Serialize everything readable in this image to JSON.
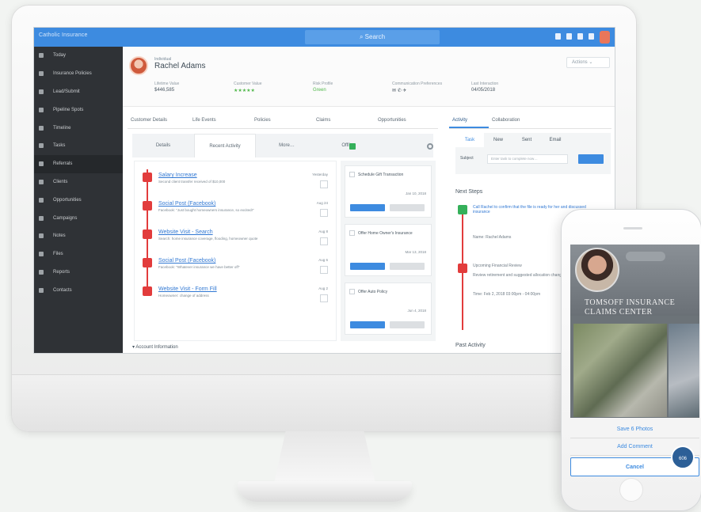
{
  "topbar": {
    "brand": "Catholic Insurance",
    "search_label": "Search"
  },
  "sidebar": {
    "items": [
      {
        "label": "Today"
      },
      {
        "label": "Insurance Policies"
      },
      {
        "label": "Lead/Submit"
      },
      {
        "label": "Pipeline Spots"
      },
      {
        "label": "Timeline"
      },
      {
        "label": "Tasks"
      },
      {
        "label": "Referrals"
      },
      {
        "label": "Clients"
      },
      {
        "label": "Opportunities"
      },
      {
        "label": "Campaigns"
      },
      {
        "label": "Notes"
      },
      {
        "label": "Files"
      },
      {
        "label": "Reports"
      },
      {
        "label": "Contacts"
      }
    ]
  },
  "profile": {
    "subtitle": "Individual",
    "name": "Rachel Adams",
    "actions_label": "Actions",
    "stats": [
      {
        "label": "Lifetime Value",
        "value": "$446,585"
      },
      {
        "label": "Customer Value",
        "value": "★★★★★",
        "green": true
      },
      {
        "label": "Risk Profile",
        "value": "Green",
        "green": true
      },
      {
        "label": "Communication Preferences",
        "value": "✉ ✆ ✈",
        "green": false
      },
      {
        "label": "Last Interaction",
        "value": "04/05/2018"
      }
    ]
  },
  "tabs": [
    "Customer Details",
    "Life Events",
    "Policies",
    "Claims",
    "Opportunities"
  ],
  "right_tabs": [
    "Activity",
    "Collaboration"
  ],
  "subtabs": [
    "Details",
    "Recent Activity",
    "More…",
    "Offline"
  ],
  "feed": [
    {
      "title": "Salary Increase",
      "desc": "Second client transfer received of $10,000",
      "time": "Yesterday"
    },
    {
      "title": "Social Post (Facebook)",
      "desc": "Facebook: \"Just bought homeowners insurance, so excited!\"",
      "time": "Aug 24"
    },
    {
      "title": "Website Visit - Search",
      "desc": "Search: home insurance coverage, flooding, homeowner quote",
      "time": "Aug 8"
    },
    {
      "title": "Social Post (Facebook)",
      "desc": "Facebook: \"Whatever insurance we have better off\"",
      "time": "Aug 6"
    },
    {
      "title": "Website Visit - Form Fill",
      "desc": "Homeowner: change of address",
      "time": "Aug 2"
    }
  ],
  "tasks": [
    {
      "name": "Schedule Gift Transaction",
      "date": "Jan 10, 2018"
    },
    {
      "name": "Offer Home Owner's Insurance",
      "date": "Mar 13, 2018"
    },
    {
      "name": "Offer Auto Policy",
      "date": "Jun 4, 2018"
    }
  ],
  "account_info": "Account Information",
  "log": {
    "tabs": [
      "Task",
      "New",
      "Sent",
      "Email"
    ],
    "subject_label": "Subject",
    "placeholder": "Enter task to complete now…"
  },
  "next_steps": {
    "title": "Next Steps",
    "step1": "Call Rachel to confirm that the file is ready for her and discussed insurance",
    "step1_meta": "Name: Rachel Adams",
    "step2": "Upcoming Financial Review",
    "step2_desc": "Review retirement and suggested allocation changes.",
    "step2_time": "Time: Feb 2, 2018 03:00pm - 04:00pm"
  },
  "past_activity": "Past Activity",
  "phone": {
    "company": "TOMSOFF INSURANCE CLAIMS CENTER",
    "save_photo": "Save 6 Photos",
    "add_comment": "Add Comment",
    "cancel": "Cancel",
    "fab": "606"
  }
}
